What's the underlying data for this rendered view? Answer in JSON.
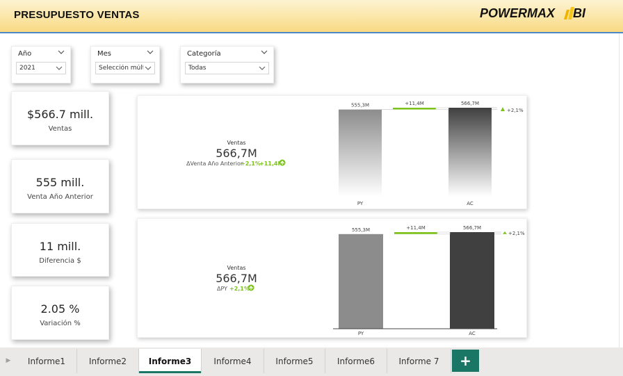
{
  "header": {
    "title": "PRESUPUESTO VENTAS",
    "logo_text": "POWERMAX",
    "logo_suffix": "BI"
  },
  "slicers": [
    {
      "label": "Año",
      "value": "2021"
    },
    {
      "label": "Mes",
      "value": "Selección múlti..."
    },
    {
      "label": "Categoría",
      "value": "Todas"
    }
  ],
  "kpis": [
    {
      "value": "$566.7 mill.",
      "label": "Ventas"
    },
    {
      "value": "555 mill.",
      "label": "Venta Año Anterior"
    },
    {
      "value": "11 mill.",
      "label": "Diferencia $"
    },
    {
      "value": "2.05 %",
      "label": "Variación %"
    }
  ],
  "colors": {
    "header_top": "#fdf3d3",
    "header_bottom": "#f8d985",
    "header_line": "#4a88c8",
    "py_bar": "#8c8c8c",
    "ac_bar": "#404040",
    "positive": "#7dc31c",
    "tab_accent": "#1a7766"
  },
  "chart_data": [
    {
      "type": "bar",
      "categories": [
        "PY",
        "AC"
      ],
      "values": [
        555.3,
        566.7
      ],
      "delta": 11.4,
      "ylim": [
        0,
        566.7
      ],
      "bar_labels": [
        "555,3M",
        "566,7M"
      ],
      "delta_label": "+11,4M",
      "percent_label": "+2,1%",
      "kpi_title": "Ventas",
      "kpi_value": "566,7M",
      "kpi_sub_label": "ΔVenta Año Anterior",
      "kpi_sub_pct": "+2,1%",
      "kpi_sub_abs": "+11,4M"
    },
    {
      "type": "bar",
      "categories": [
        "PY",
        "AC"
      ],
      "values": [
        555.3,
        566.7
      ],
      "delta": 11.4,
      "ylim": [
        0,
        566.7
      ],
      "bar_labels": [
        "555,3M",
        "566,7M"
      ],
      "delta_label": "+11,4M",
      "percent_label": "+2,1%",
      "kpi_title": "Ventas",
      "kpi_value": "566,7M",
      "kpi_sub_label": "ΔPY",
      "kpi_sub_pct": "+2,1%"
    }
  ],
  "tabs": [
    {
      "label": "Informe1",
      "active": false
    },
    {
      "label": "Informe2",
      "active": false
    },
    {
      "label": "Informe3",
      "active": true
    },
    {
      "label": "Informe4",
      "active": false
    },
    {
      "label": "Informe5",
      "active": false
    },
    {
      "label": "Informe6",
      "active": false
    },
    {
      "label": "Informe 7",
      "active": false
    }
  ],
  "tab_add_label": "+"
}
